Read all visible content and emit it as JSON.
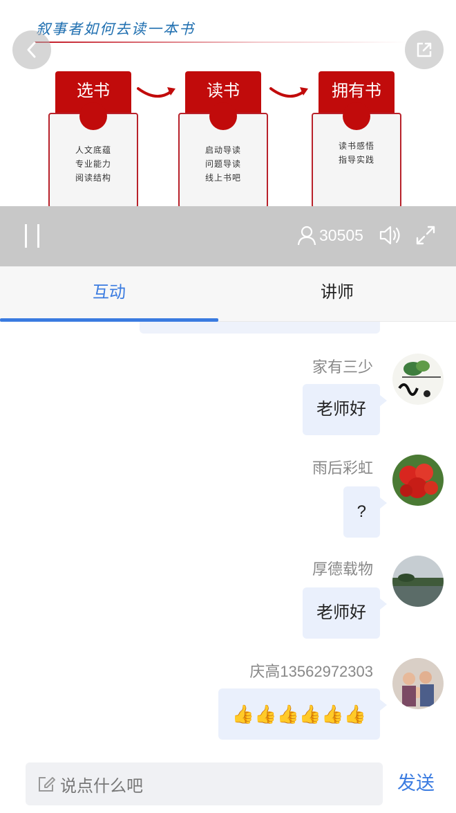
{
  "video": {
    "slide_title": "叙事者如何去读一本书",
    "cards": [
      {
        "tab": "选书",
        "lines": [
          "人文底蕴",
          "专业能力",
          "阅读结构"
        ]
      },
      {
        "tab": "读书",
        "lines": [
          "启动导读",
          "问题导读",
          "线上书吧"
        ]
      },
      {
        "tab": "拥有书",
        "lines": [
          "读书感悟",
          "指导实践"
        ]
      }
    ],
    "viewer_count": "30505",
    "icons": {
      "back": "chevron-left-icon",
      "share": "share-icon",
      "pause": "pause-icon",
      "viewers": "person-icon",
      "volume": "volume-icon",
      "fullscreen": "fullscreen-icon"
    },
    "accent_color": "#c10b0b"
  },
  "tabs": {
    "interact": "互动",
    "teacher": "讲师",
    "active_color": "#3a7be0"
  },
  "chat": {
    "messages": [
      {
        "name": "家有三少",
        "text": "老师好"
      },
      {
        "name": "雨后彩虹",
        "text": "?"
      },
      {
        "name": "厚德载物",
        "text": "老师好"
      },
      {
        "name": "庆高13562972303",
        "text": "👍👍👍👍👍👍"
      }
    ]
  },
  "input": {
    "placeholder": "说点什么吧",
    "send": "发送"
  }
}
